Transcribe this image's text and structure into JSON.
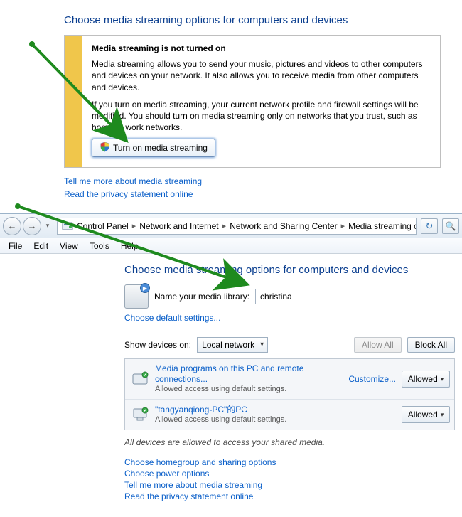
{
  "top": {
    "heading": "Choose media streaming options for computers and devices",
    "info_title": "Media streaming is not turned on",
    "info_p1": "Media streaming allows you to send your music, pictures and videos to other computers and devices on your network.  It also allows you to receive media from other computers and devices.",
    "info_p2": "If you turn on media streaming, your current network profile and firewall settings will be modified. You should turn on media streaming only on networks that you trust, such as home or work networks.",
    "turn_on_label": "Turn on media streaming",
    "link_learn": "Tell me more about media streaming",
    "link_privacy": "Read the privacy statement online"
  },
  "nav": {
    "crumbs": [
      "Control Panel",
      "Network and Internet",
      "Network and Sharing Center",
      "Media streaming options"
    ]
  },
  "menu": [
    "File",
    "Edit",
    "View",
    "Tools",
    "Help"
  ],
  "lower": {
    "heading": "Choose media streaming options for computers and devices",
    "name_label": "Name your media library:",
    "name_value": "christina",
    "choose_defaults": "Choose default settings...",
    "show_devices_label": "Show devices on:",
    "show_devices_value": "Local network",
    "allow_all": "Allow All",
    "block_all": "Block All",
    "devices": [
      {
        "title": "Media programs on this PC and remote connections...",
        "sub": "Allowed access using default settings.",
        "customize": "Customize...",
        "button": "Allowed"
      },
      {
        "title": "\"tangyanqiong-PC\"的PC",
        "sub": "Allowed access using default settings.",
        "customize": "",
        "button": "Allowed"
      }
    ],
    "summary": "All devices are allowed to access your shared media.",
    "footer_links": [
      "Choose homegroup and sharing options",
      "Choose power options",
      "Tell me more about media streaming",
      "Read the privacy statement online"
    ]
  }
}
